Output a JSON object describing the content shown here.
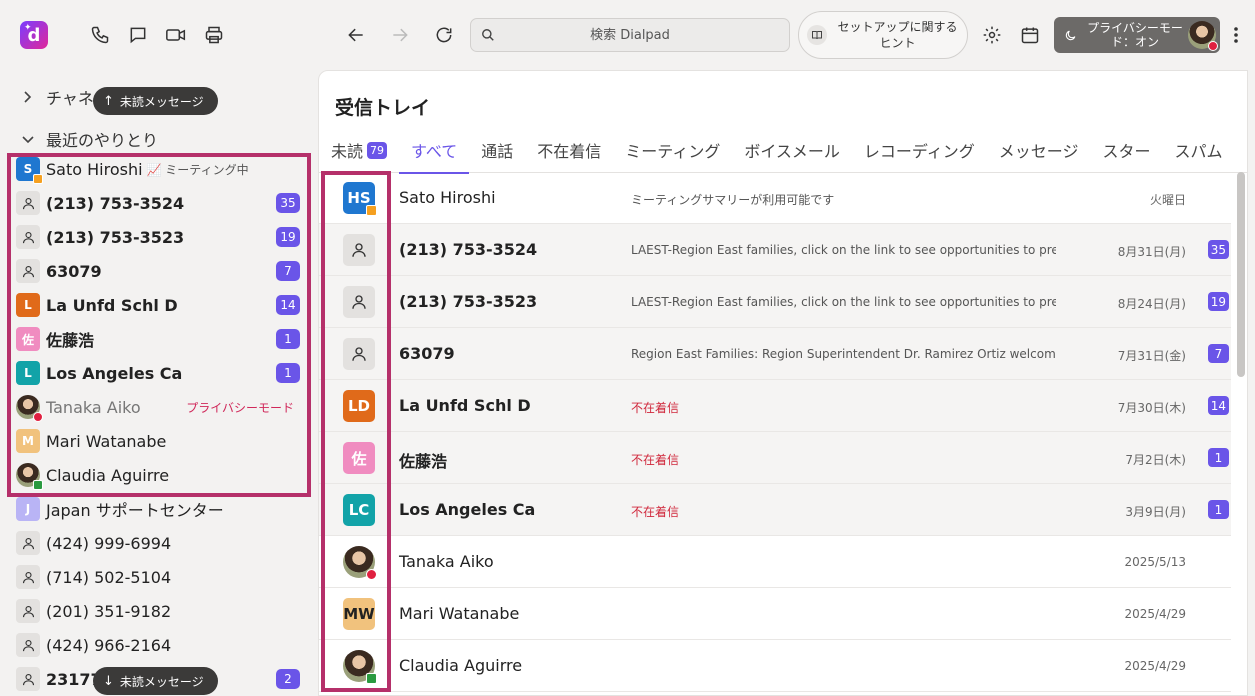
{
  "toolbar": {
    "logo_letter": "d",
    "search_placeholder": "検索 Dialpad",
    "hints_label": "セットアップに関するヒント",
    "privacy_label": "プライバシーモード：オン",
    "icons": [
      "phone-icon",
      "chat-icon",
      "video-icon",
      "print-icon",
      "back-arrow-icon",
      "forward-arrow-icon",
      "refresh-icon",
      "search-icon",
      "book-icon",
      "gear-icon",
      "calendar-icon",
      "moon-icon",
      "more-icon"
    ]
  },
  "sidebar": {
    "channels_label": "チャネル",
    "recent_label": "最近のやりとり",
    "unread_pill_top": "未読メッセージ",
    "unread_pill_bottom": "未読メッセージ",
    "items": [
      {
        "initial": "S",
        "name": "Sato Hiroshi",
        "color": "#1f77d0",
        "bold": false,
        "status": "orange",
        "tag": "📈 ミーティング中"
      },
      {
        "name": "(213) 753-3524",
        "type": "person",
        "bold": true,
        "badge": "35"
      },
      {
        "name": "(213) 753-3523",
        "type": "person",
        "bold": true,
        "badge": "19"
      },
      {
        "name": "63079",
        "type": "person",
        "bold": true,
        "badge": "7"
      },
      {
        "initial": "L",
        "name": "La Unfd Schl D",
        "color": "#e06a1a",
        "bold": true,
        "badge": "14"
      },
      {
        "initial": "佐",
        "name": "佐藤浩",
        "color": "#f08cc0",
        "bold": true,
        "badge": "1"
      },
      {
        "initial": "L",
        "name": "Los Angeles Ca",
        "color": "#12a3a8",
        "bold": true,
        "badge": "1"
      },
      {
        "name": "Tanaka Aiko",
        "type": "photo",
        "bold": false,
        "status": "red",
        "privacy": "プライバシーモード"
      },
      {
        "initial": "M",
        "name": "Mari Watanabe",
        "color": "#f1c27d",
        "bold": false
      },
      {
        "name": "Claudia Aguirre",
        "type": "photo",
        "bold": false,
        "status": "green"
      },
      {
        "initial": "J",
        "name": "Japan サポートセンター",
        "color": "#b9b4f5",
        "bold": false
      },
      {
        "name": "(424) 999-6994",
        "type": "person",
        "bold": false
      },
      {
        "name": "(714) 502-5104",
        "type": "person",
        "bold": false
      },
      {
        "name": "(201) 351-9182",
        "type": "person",
        "bold": false
      },
      {
        "name": "(424) 966-2164",
        "type": "person",
        "bold": false
      },
      {
        "name": "23177",
        "type": "person",
        "bold": true,
        "badge": "2"
      }
    ]
  },
  "main": {
    "title": "受信トレイ",
    "tabs": [
      {
        "label": "未読",
        "count": "79"
      },
      {
        "label": "すべて",
        "active": true
      },
      {
        "label": "通話"
      },
      {
        "label": "不在着信"
      },
      {
        "label": "ミーティング"
      },
      {
        "label": "ボイスメール"
      },
      {
        "label": "レコーディング"
      },
      {
        "label": "メッセージ"
      },
      {
        "label": "スター"
      },
      {
        "label": "スパム"
      }
    ],
    "rows": [
      {
        "avatar": "HS",
        "color": "#1f77d0",
        "status": "orange",
        "name": "Sato Hiroshi",
        "bold": false,
        "preview": "ミーティングサマリーが利用可能です",
        "date": "火曜日"
      },
      {
        "type": "person",
        "name": "(213) 753-3524",
        "bold": true,
        "preview": "LAEST-Region East families, click on the link to see opportunities to prev",
        "date": "8月31日(月)",
        "badge": "35"
      },
      {
        "type": "person",
        "name": "(213) 753-3523",
        "bold": true,
        "preview": "LAEST-Region East families, click on the link to see opportunities to prev",
        "date": "8月24日(月)",
        "badge": "19"
      },
      {
        "type": "person",
        "name": "63079",
        "bold": true,
        "preview": "Region East Families: Region Superintendent Dr. Ramirez Ortiz welcomes",
        "date": "7月31日(金)",
        "badge": "7"
      },
      {
        "avatar": "LD",
        "color": "#e06a1a",
        "name": "La Unfd Schl D",
        "bold": true,
        "preview": "不在着信",
        "red": true,
        "date": "7月30日(木)",
        "badge": "14"
      },
      {
        "avatar": "佐",
        "color": "#f08cc0",
        "name": "佐藤浩",
        "bold": true,
        "preview": "不在着信",
        "red": true,
        "date": "7月2日(木)",
        "badge": "1"
      },
      {
        "avatar": "LC",
        "color": "#12a3a8",
        "name": "Los Angeles Ca",
        "bold": true,
        "preview": "不在着信",
        "red": true,
        "date": "3月9日(月)",
        "badge": "1"
      },
      {
        "type": "photo",
        "status": "red",
        "name": "Tanaka Aiko",
        "bold": false,
        "preview": "",
        "date": "2025/5/13"
      },
      {
        "avatar": "MW",
        "color": "#f1c27d",
        "dark": true,
        "name": "Mari Watanabe",
        "bold": false,
        "preview": "",
        "date": "2025/4/29"
      },
      {
        "type": "photo",
        "status": "green",
        "name": "Claudia Aguirre",
        "bold": false,
        "preview": "",
        "date": "2025/4/29"
      }
    ]
  }
}
